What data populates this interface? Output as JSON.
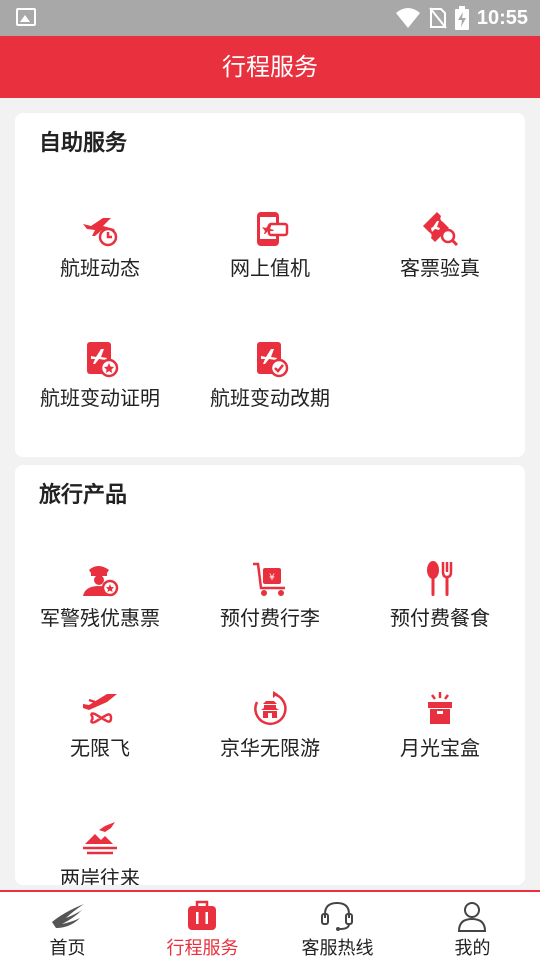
{
  "status_bar": {
    "time": "10:55"
  },
  "header": {
    "title": "行程服务"
  },
  "self_service": {
    "title": "自助服务",
    "items": [
      {
        "label": "航班动态",
        "icon": "flight-clock-icon"
      },
      {
        "label": "网上值机",
        "icon": "phone-boarding-icon"
      },
      {
        "label": "客票验真",
        "icon": "ticket-verify-icon"
      },
      {
        "label": "航班变动证明",
        "icon": "flight-certificate-icon"
      },
      {
        "label": "航班变动改期",
        "icon": "flight-reschedule-icon"
      }
    ]
  },
  "travel_products": {
    "title": "旅行产品",
    "items": [
      {
        "label": "军警残优惠票",
        "icon": "officer-discount-icon"
      },
      {
        "label": "预付费行李",
        "icon": "luggage-cart-icon"
      },
      {
        "label": "预付费餐食",
        "icon": "spoon-fork-icon"
      },
      {
        "label": "无限飞",
        "icon": "infinite-flight-icon"
      },
      {
        "label": "京华无限游",
        "icon": "temple-tour-icon"
      },
      {
        "label": "月光宝盒",
        "icon": "gift-box-icon"
      },
      {
        "label": "两岸往来",
        "icon": "cross-strait-icon"
      }
    ]
  },
  "bottom_nav": [
    {
      "label": "首页",
      "icon": "home-logo-icon"
    },
    {
      "label": "行程服务",
      "icon": "suitcase-icon",
      "active": true
    },
    {
      "label": "客服热线",
      "icon": "headset-icon"
    },
    {
      "label": "我的",
      "icon": "person-icon"
    }
  ],
  "colors": {
    "accent": "#e8303e",
    "status_bar": "#a8a8a8"
  }
}
